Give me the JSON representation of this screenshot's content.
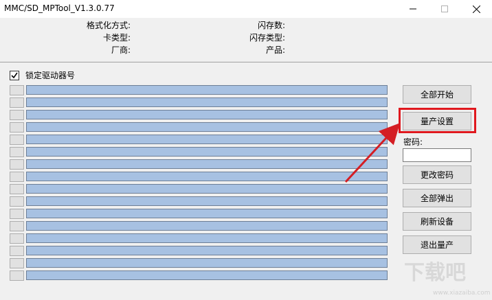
{
  "window": {
    "title": "MMC/SD_MPTool_V1.3.0.77"
  },
  "info": {
    "format_label": "格式化方式:",
    "card_type_label": "卡类型:",
    "vendor_label": "厂商:",
    "flash_count_label": "闪存数:",
    "flash_type_label": "闪存类型:",
    "product_label": "产品:"
  },
  "lock": {
    "label": "锁定驱动器号",
    "checked": true
  },
  "buttons": {
    "start_all": "全部开始",
    "mp_settings": "量产设置",
    "change_password": "更改密码",
    "eject_all": "全部弹出",
    "refresh": "刷新设备",
    "exit": "退出量产"
  },
  "password": {
    "label": "密码:",
    "value": ""
  },
  "watermark": {
    "text": "下载吧",
    "sub": "www.xiazaiba.com"
  },
  "colors": {
    "highlight": "#e0181e",
    "bar": "#a7c1e2"
  }
}
